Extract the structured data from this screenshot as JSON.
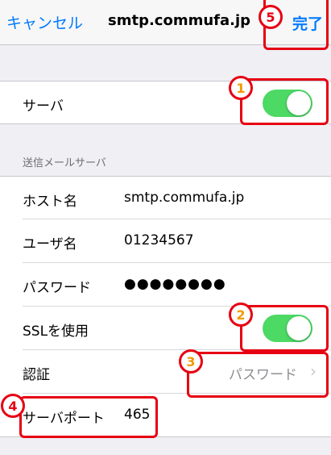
{
  "navbar": {
    "cancel_label": "キャンセル",
    "title": "smtp.commufa.jp",
    "done_label": "完了"
  },
  "server_row": {
    "label": "サーバ",
    "enabled": true
  },
  "outgoing": {
    "section_title": "送信メールサーバ",
    "host": {
      "label": "ホスト名",
      "value": "smtp.commufa.jp"
    },
    "user": {
      "label": "ユーザ名",
      "value": "01234567"
    },
    "password": {
      "label": "パスワード",
      "value": "●●●●●●●●"
    },
    "ssl": {
      "label": "SSLを使用",
      "enabled": true
    },
    "auth": {
      "label": "認証",
      "value": "パスワード"
    },
    "port": {
      "label": "サーバポート",
      "value": "465"
    }
  },
  "annotations": [
    "1",
    "2",
    "3",
    "4",
    "5"
  ],
  "colors": {
    "accent": "#007aff",
    "toggle_on": "#4cd964",
    "annotation": "#e60012"
  },
  "icons": [
    "chevron-right-icon"
  ]
}
